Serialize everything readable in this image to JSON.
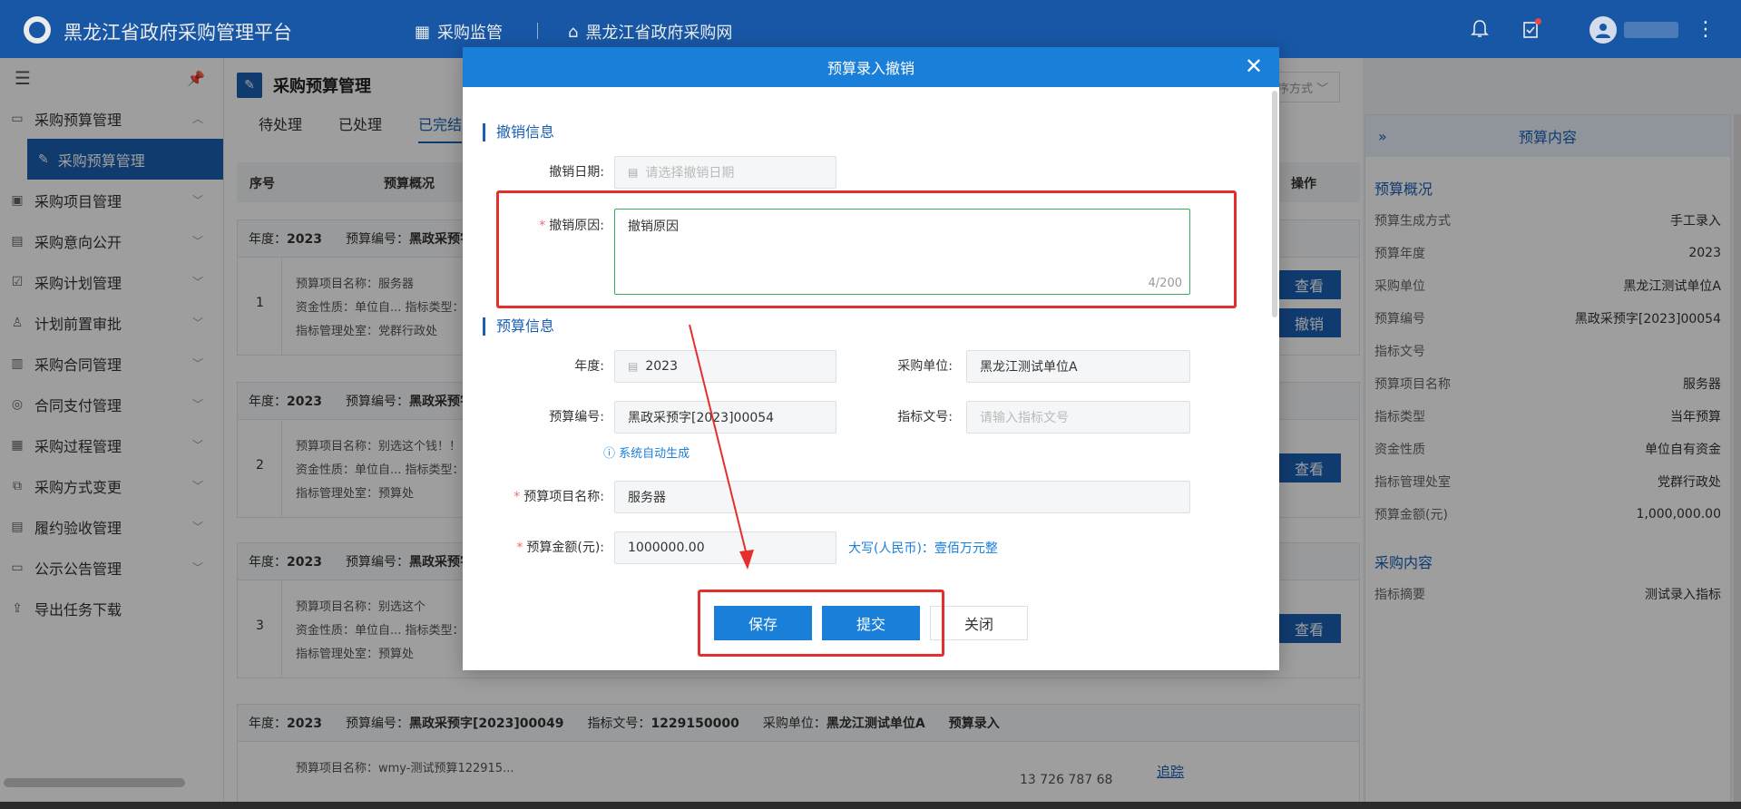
{
  "header": {
    "title": "黑龙江省政府采购管理平台",
    "nav": [
      {
        "label": "采购监管",
        "icon": "grid-icon"
      },
      {
        "label": "黑龙江省政府采购网",
        "icon": "home-icon"
      }
    ]
  },
  "sidebar": {
    "items": [
      {
        "label": "采购预算管理",
        "icon": "budget-icon",
        "expanded": true
      },
      {
        "label": "采购预算管理",
        "icon": "edit-icon",
        "selected": true
      },
      {
        "label": "采购项目管理",
        "icon": "project-icon"
      },
      {
        "label": "采购意向公开",
        "icon": "intent-icon"
      },
      {
        "label": "采购计划管理",
        "icon": "plan-icon"
      },
      {
        "label": "计划前置审批",
        "icon": "approval-icon"
      },
      {
        "label": "采购合同管理",
        "icon": "contract-icon"
      },
      {
        "label": "合同支付管理",
        "icon": "payment-icon"
      },
      {
        "label": "采购过程管理",
        "icon": "process-icon"
      },
      {
        "label": "采购方式变更",
        "icon": "change-icon"
      },
      {
        "label": "履约验收管理",
        "icon": "acceptance-icon"
      },
      {
        "label": "公示公告管理",
        "icon": "notice-icon"
      },
      {
        "label": "导出任务下载",
        "icon": "download-icon"
      }
    ]
  },
  "page": {
    "title": "采购预算管理",
    "tabs": [
      "待处理",
      "已处理",
      "已完结"
    ],
    "sort_placeholder": "排序方式",
    "columns": [
      "序号",
      "预算概况",
      "操作"
    ],
    "groups": [
      {
        "year_label": "年度：",
        "year": "2023",
        "code_label": "预算编号：",
        "code": "黑政采预字[",
        "index": "1",
        "l1": "预算项目名称：服务器",
        "l2": "资金性质：单位自... 指标类型：",
        "l3": "指标管理处室：党群行政处",
        "buttons": [
          "查看",
          "撤销"
        ]
      },
      {
        "year_label": "年度：",
        "year": "2023",
        "code_label": "预算编号：",
        "code": "黑政采预字[",
        "index": "2",
        "l1": "预算项目名称：别选这个钱！！",
        "l2": "资金性质：单位自... 指标类型：",
        "l3": "指标管理处室：预算处",
        "buttons": [
          "查看"
        ]
      },
      {
        "year_label": "年度：",
        "year": "2023",
        "code_label": "预算编号：",
        "code": "黑政采预字[",
        "index": "3",
        "l1": "预算项目名称：别选这个",
        "l2": "资金性质：单位自... 指标类型：",
        "l3": "指标管理处室：预算处",
        "buttons": [
          "查看"
        ]
      }
    ],
    "last_group": {
      "year_label": "年度：",
      "year": "2023",
      "code_label": "预算编号：",
      "code": "黑政采预字[2023]00049",
      "doc_label": "指标文号：",
      "doc": "1229150000",
      "unit_label": "采购单位：",
      "unit": "黑龙江测试单位A",
      "type": "预算录入",
      "l1": "预算项目名称：wmy-测试预算122915...",
      "amount": "13 726 787 68",
      "track": "追踪"
    }
  },
  "right_panel": {
    "title": "预算内容",
    "section1": "预算概况",
    "rows": [
      {
        "k": "预算生成方式",
        "v": "手工录入"
      },
      {
        "k": "预算年度",
        "v": "2023"
      },
      {
        "k": "采购单位",
        "v": "黑龙江测试单位A"
      },
      {
        "k": "预算编号",
        "v": "黑政采预字[2023]00054"
      },
      {
        "k": "指标文号",
        "v": ""
      },
      {
        "k": "预算项目名称",
        "v": "服务器"
      },
      {
        "k": "指标类型",
        "v": "当年预算"
      },
      {
        "k": "资金性质",
        "v": "单位自有资金"
      },
      {
        "k": "指标管理处室",
        "v": "党群行政处"
      },
      {
        "k": "预算金额(元)",
        "v": "1,000,000.00"
      }
    ],
    "section2": "采购内容",
    "rows2": [
      {
        "k": "指标摘要",
        "v": "测试录入指标"
      }
    ]
  },
  "modal": {
    "title": "预算录入撤销",
    "close": "✕",
    "cancel_section": "撤销信息",
    "cancel_date_label": "撤销日期:",
    "cancel_date_placeholder": "请选择撤销日期",
    "cancel_reason_label": "撤销原因:",
    "cancel_reason_value": "撤销原因",
    "cancel_reason_counter": "4/200",
    "budget_section": "预算信息",
    "year_label": "年度:",
    "year_value": "2023",
    "unit_label": "采购单位:",
    "unit_value": "黑龙江测试单位A",
    "code_label": "预算编号:",
    "code_value": "黑政采预字[2023]00054",
    "doc_label": "指标文号:",
    "doc_placeholder": "请输入指标文号",
    "auto_hint": "系统自动生成",
    "name_label": "预算项目名称:",
    "name_value": "服务器",
    "amount_label": "预算金额(元):",
    "amount_value": "1000000.00",
    "amount_cn": "大写(人民币)：壹佰万元整",
    "buttons": {
      "save": "保存",
      "submit": "提交",
      "close": "关闭"
    }
  },
  "colors": {
    "brand": "#1a5fb4",
    "modal_header": "#1a7fd8",
    "annotation": "#e52e2e",
    "focus_border": "#3aad5b"
  }
}
